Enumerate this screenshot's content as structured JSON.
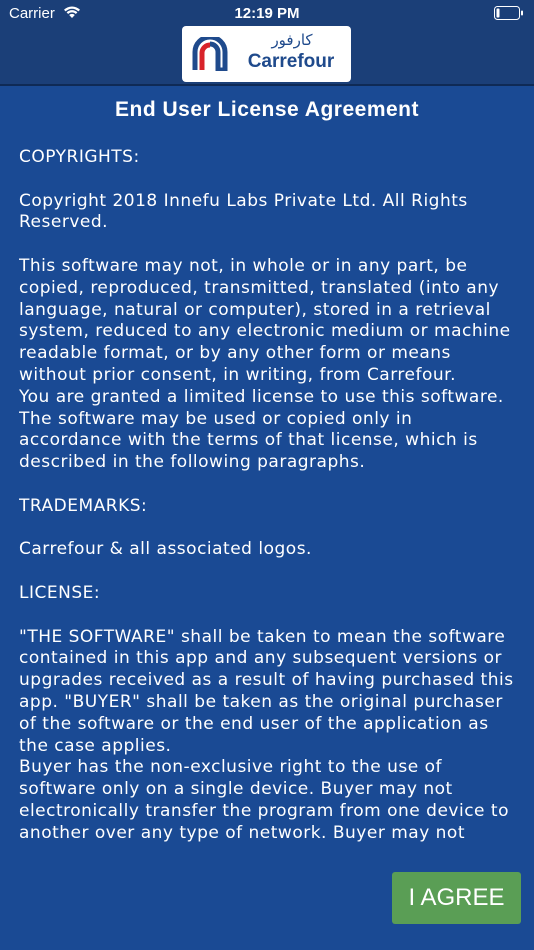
{
  "status_bar": {
    "carrier": "Carrier",
    "time": "12:19 PM"
  },
  "logo": {
    "arabic": "كارفور",
    "name": "Carrefour"
  },
  "title": "End User License Agreement",
  "paragraphs": [
    "COPYRIGHTS:",
    "Copyright 2018 Innefu Labs Private Ltd. All Rights Reserved.",
    "This software may not, in whole or in any part, be copied, reproduced, transmitted, translated (into any language, natural or computer), stored in a retrieval system, reduced to any electronic medium or machine readable  format, or by any other form or means without prior consent, in writing, from Carrefour.",
    "You are granted a limited license to use this software. The software may be used or copied only in accordance with the terms of that license, which is described in the following paragraphs.",
    "TRADEMARKS:",
    "Carrefour  & all associated logos.",
    "LICENSE:",
    "\"THE SOFTWARE\" shall be taken to mean the software contained in this app and any subsequent versions or upgrades received as a result of having purchased this app. \"BUYER\" shall be taken as the original purchaser of the software or the end user of the application as the case applies.",
    "Buyer has the non-exclusive right to the use of software only on a single device. Buyer may not electronically  transfer the program from one device to another over any type of network. Buyer may not"
  ],
  "agree_button": "I AGREE",
  "colors": {
    "background": "#1a4a94",
    "header": "#1b3f78",
    "button": "#5a9e55",
    "logo_text": "#1f4a8c"
  }
}
